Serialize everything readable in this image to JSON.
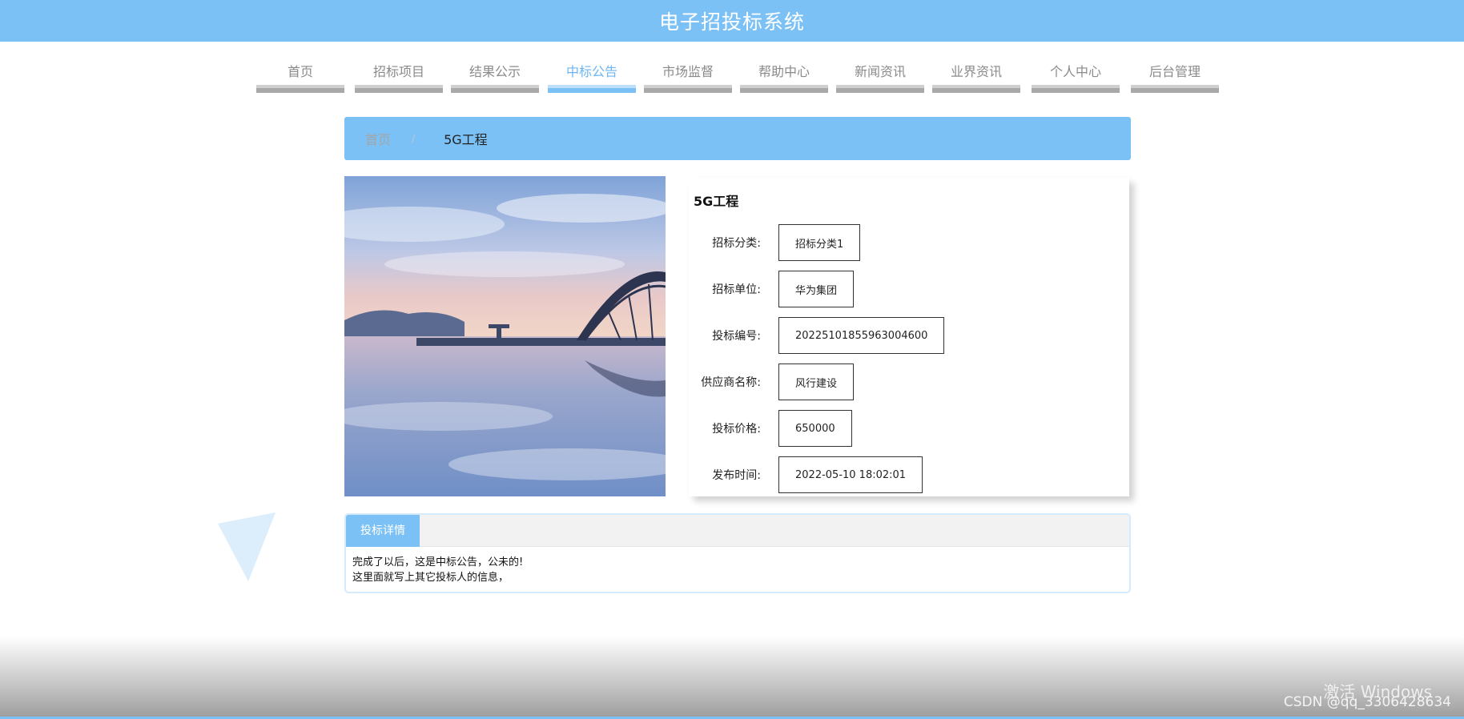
{
  "header": {
    "title": "电子招投标系统"
  },
  "nav": {
    "items": [
      {
        "label": "首页"
      },
      {
        "label": "招标项目"
      },
      {
        "label": "结果公示"
      },
      {
        "label": "中标公告"
      },
      {
        "label": "市场监督"
      },
      {
        "label": "帮助中心"
      },
      {
        "label": "新闻资讯"
      },
      {
        "label": "业界资讯"
      },
      {
        "label": "个人中心"
      },
      {
        "label": "后台管理"
      }
    ],
    "active": "中标公告"
  },
  "breadcrumb": {
    "home": "首页",
    "separator": "/",
    "current": "5G工程"
  },
  "detail": {
    "title": "5G工程",
    "fields": [
      {
        "label": "招标分类:",
        "value": "招标分类1"
      },
      {
        "label": "招标单位:",
        "value": "华为集团"
      },
      {
        "label": "投标编号:",
        "value": "20225101855963004600"
      },
      {
        "label": "供应商名称:",
        "value": "风行建设"
      },
      {
        "label": "投标价格:",
        "value": "650000"
      },
      {
        "label": "发布时间:",
        "value": "2022-05-10 18:02:01"
      }
    ]
  },
  "bid_details": {
    "tab_label": "投标详情",
    "lines": [
      "完成了以后，这是中标公告，公未的!",
      "这里面就写上其它投标人的信息，"
    ]
  },
  "overlay": {
    "windows_watermark": "激活 Windows",
    "csdn": "CSDN @qq_3306428634"
  },
  "colors": {
    "primary": "#7cc1f5",
    "nav_bar": "#a9a9a9"
  },
  "icons": {
    "decoration": "triangle-shape"
  }
}
